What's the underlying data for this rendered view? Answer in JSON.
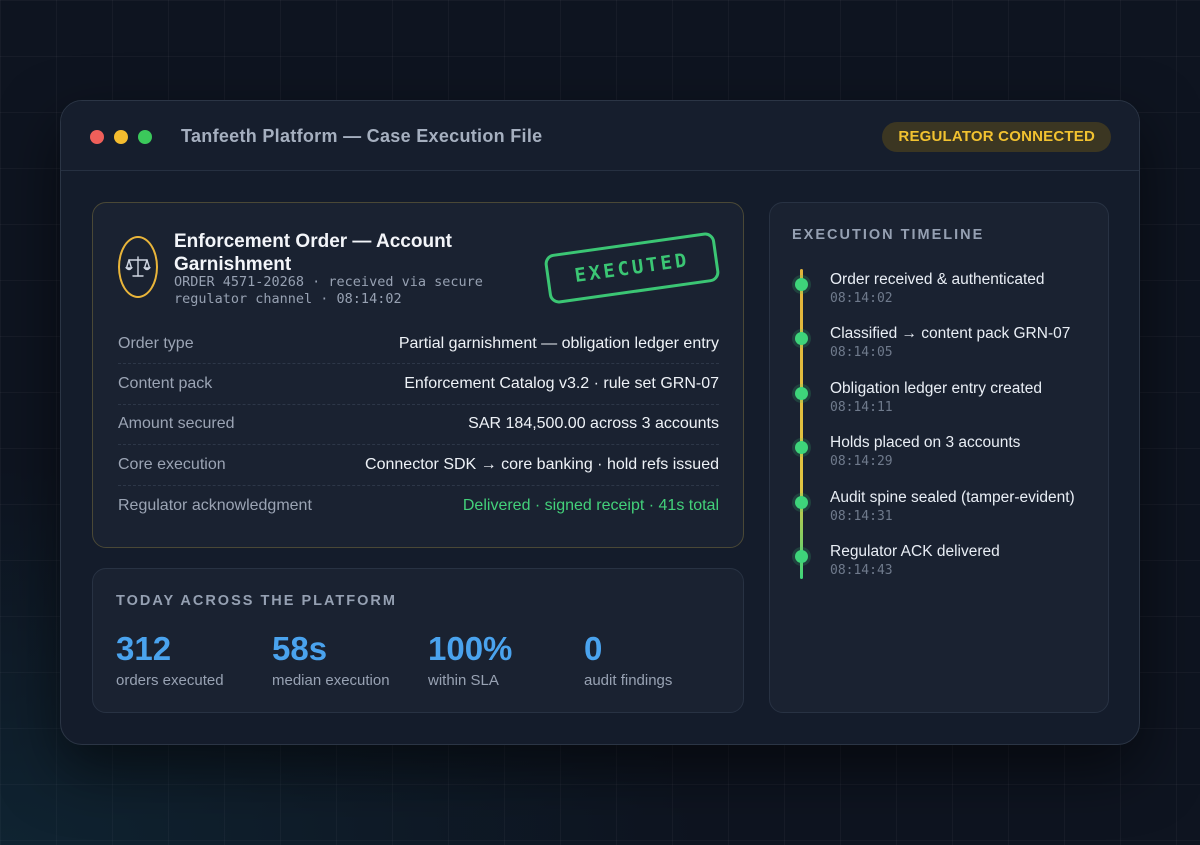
{
  "window": {
    "title": "Tanfeeth Platform — Case Execution File",
    "badge": "REGULATOR CONNECTED"
  },
  "order": {
    "icon": "scales-icon",
    "title": "Enforcement Order — Account Garnishment",
    "meta": "ORDER 4571-20268 · received via secure regulator channel · 08:14:02",
    "stamp": "EXECUTED",
    "rows": [
      {
        "label": "Order type",
        "value": "Partial garnishment — obligation ledger entry"
      },
      {
        "label": "Content pack",
        "value": "Enforcement Catalog v3.2 · rule set GRN-07"
      },
      {
        "label": "Amount secured",
        "value": "SAR 184,500.00 across 3 accounts"
      },
      {
        "label": "Core execution",
        "value": "Connector SDK → core banking · hold refs issued"
      },
      {
        "label": "Regulator acknowledgment",
        "value": "Delivered · signed receipt · 41s total"
      }
    ]
  },
  "stats": {
    "heading": "TODAY ACROSS THE PLATFORM",
    "items": [
      {
        "value": "312",
        "label": "orders executed"
      },
      {
        "value": "58s",
        "label": "median execution"
      },
      {
        "value": "100%",
        "label": "within SLA"
      },
      {
        "value": "0",
        "label": "audit findings"
      }
    ]
  },
  "timeline": {
    "heading": "EXECUTION TIMELINE",
    "events": [
      {
        "text": "Order received & authenticated",
        "time": "08:14:02"
      },
      {
        "text": "Classified → content pack GRN-07",
        "time": "08:14:05"
      },
      {
        "text": "Obligation ledger entry created",
        "time": "08:14:11"
      },
      {
        "text": "Holds placed on 3 accounts",
        "time": "08:14:29"
      },
      {
        "text": "Audit spine sealed (tamper-evident)",
        "time": "08:14:31"
      },
      {
        "text": "Regulator ACK delivered",
        "time": "08:14:43"
      }
    ]
  },
  "colors": {
    "accent_blue": "#4aa3ee",
    "success_green": "#3ed47a",
    "badge_gold": "#f2c230"
  }
}
